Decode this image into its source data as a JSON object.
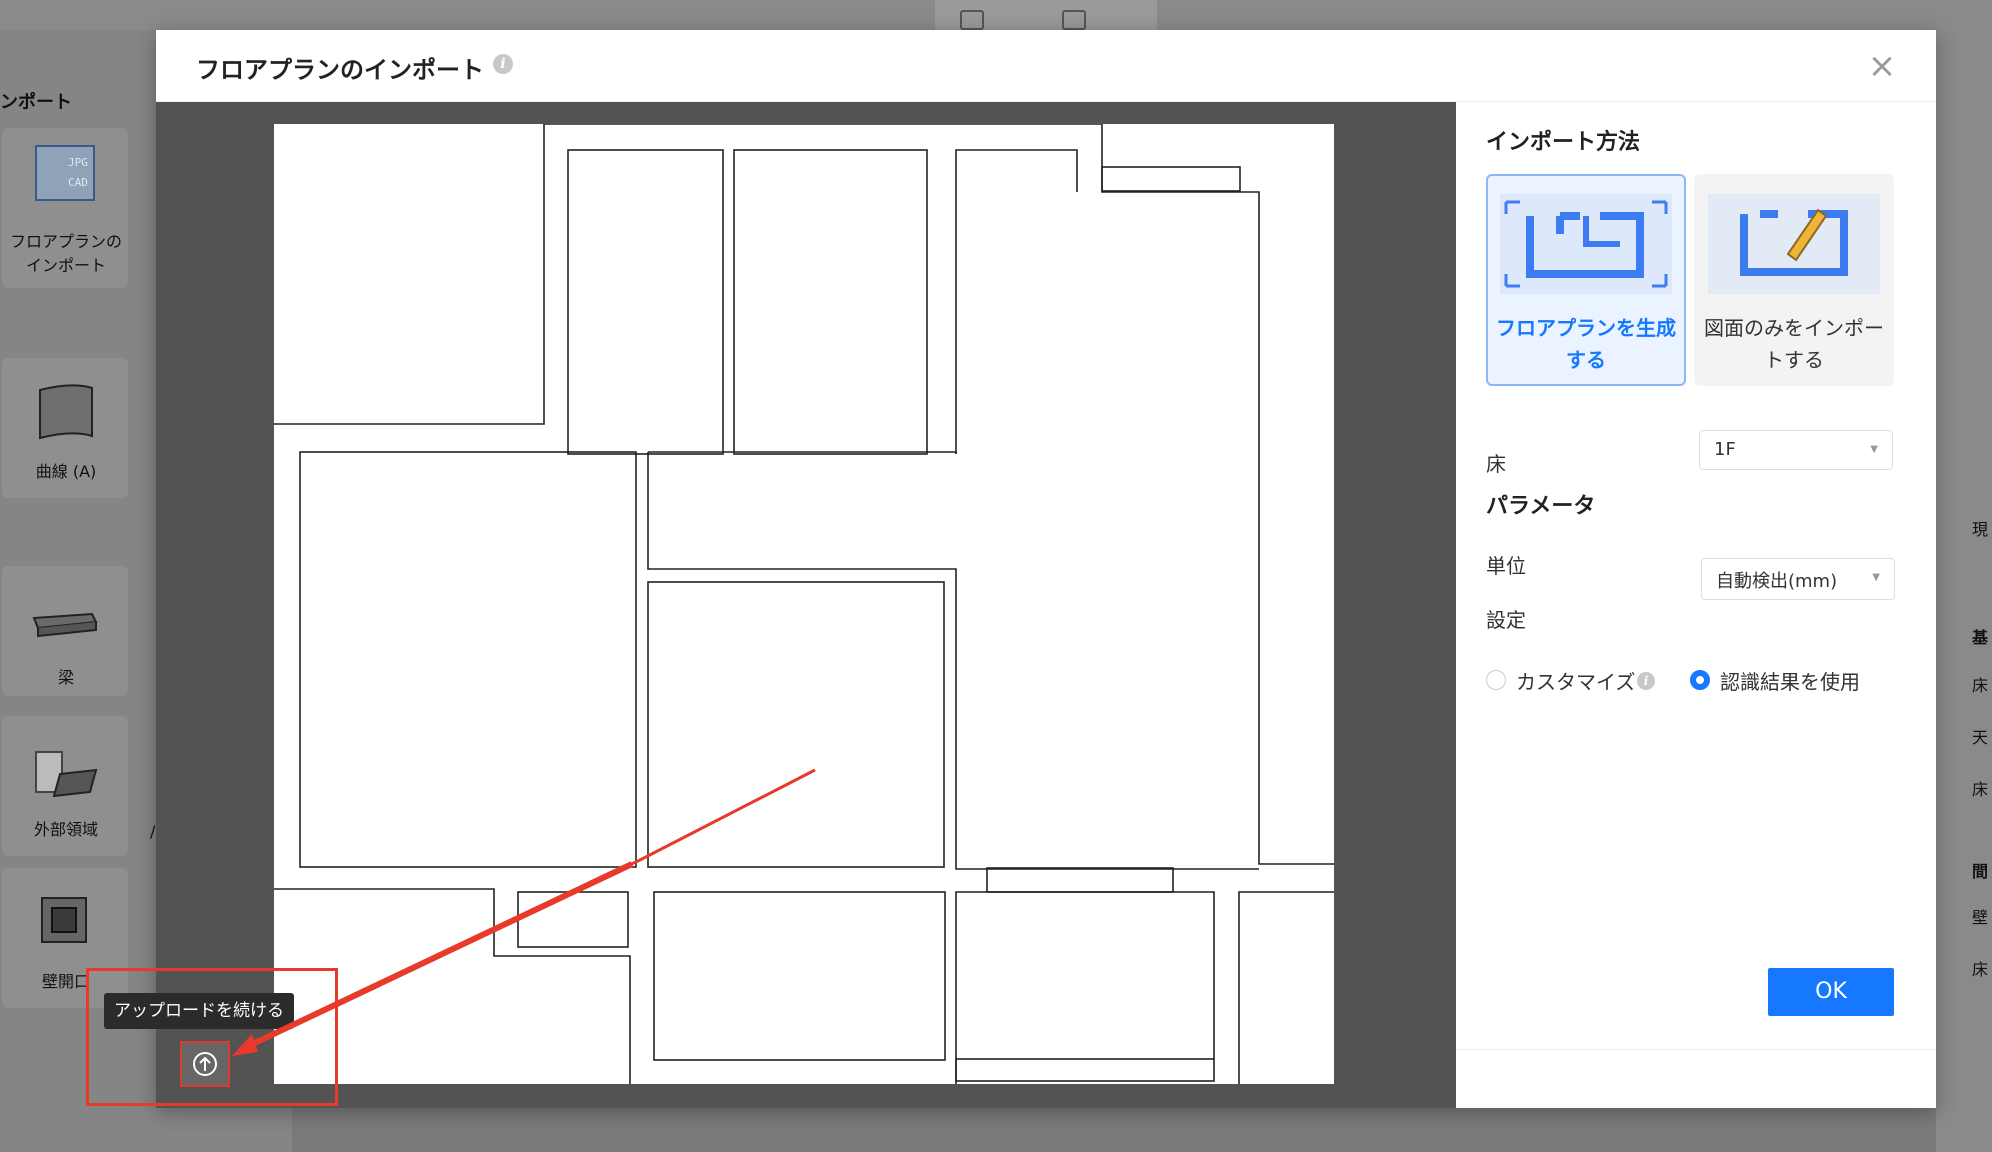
{
  "background": {
    "left_panel": {
      "title": "ンポート",
      "items": [
        {
          "label_line1": "フロアプランの",
          "label_line2": "インポート",
          "icon": "jpg-cad-icon"
        },
        {
          "label": "曲線 (A)",
          "icon": "curved-wall-icon"
        },
        {
          "label": "梁",
          "icon": "beam-icon"
        },
        {
          "label": "外部領域",
          "icon": "outdoor-area-icon"
        },
        {
          "label": "壁開口",
          "icon": "wall-opening-icon"
        }
      ],
      "stray_char": "/"
    },
    "right_edge_chars": [
      "現",
      "基",
      "床",
      "天",
      "床",
      "間",
      "壁",
      "床"
    ]
  },
  "dialog": {
    "title": "フロアプランのインポート",
    "info_glyph": "i",
    "close_glyph": "×"
  },
  "side": {
    "import_method_title": "インポート方法",
    "methods": [
      {
        "label": "フロアプランを生成する",
        "selected": true,
        "icon": "floorplan-generate-icon"
      },
      {
        "label": "図面のみをインポートする",
        "selected": false,
        "icon": "drawing-import-icon"
      }
    ],
    "floor": {
      "label": "床",
      "value": "1F"
    },
    "params_title": "パラメータ",
    "unit": {
      "label": "単位",
      "value": "自動検出(mm)"
    },
    "settings": {
      "label": "設定",
      "options": [
        {
          "label": "カスタマイズ",
          "selected": false,
          "has_info": true
        },
        {
          "label": "認識結果を使用",
          "selected": true
        }
      ]
    },
    "ok_label": "OK"
  },
  "upload": {
    "tooltip": "アップロードを続ける",
    "icon": "cloud-upload-icon"
  },
  "colors": {
    "accent": "#1677ff",
    "annotation": "#e83a2a",
    "preview_bg": "#535353"
  }
}
